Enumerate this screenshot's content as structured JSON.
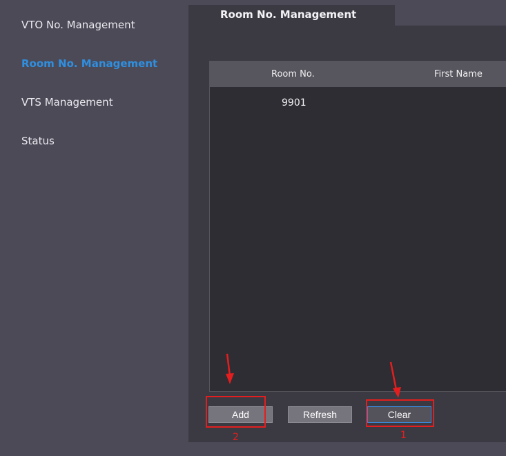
{
  "sidebar": {
    "items": [
      {
        "label": "VTO No. Management"
      },
      {
        "label": "Room No. Management"
      },
      {
        "label": "VTS Management"
      },
      {
        "label": "Status"
      }
    ]
  },
  "tabs": [
    {
      "label": "Room No. Management"
    }
  ],
  "table": {
    "columns": [
      "Room No.",
      "First Name"
    ],
    "rows": [
      [
        "9901",
        ""
      ]
    ]
  },
  "buttons": {
    "add": "Add",
    "refresh": "Refresh",
    "clear": "Clear"
  },
  "annotations": {
    "add_marker": "2",
    "clear_marker": "1",
    "color": "#e41e1e"
  },
  "colors": {
    "active_nav": "#2f8fe0",
    "background": "#4c4a57",
    "panel": "#3b3a43",
    "grid": "#2e2d33"
  }
}
